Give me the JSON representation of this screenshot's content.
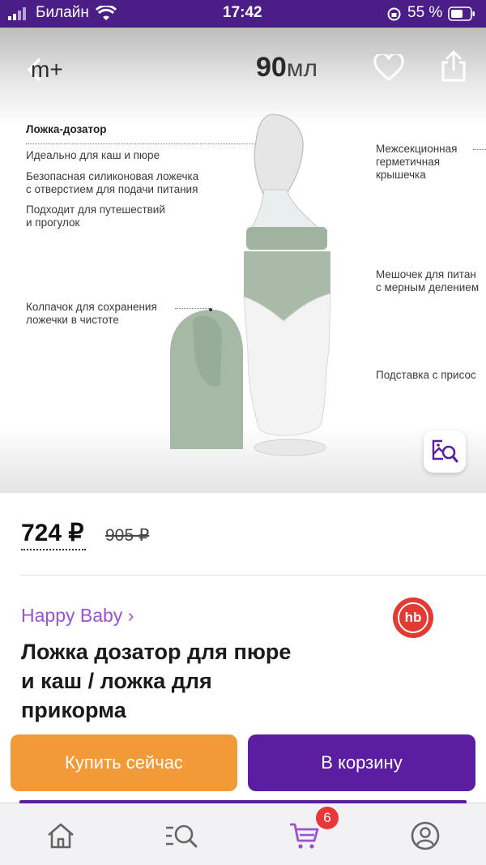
{
  "status": {
    "carrier": "Билайн",
    "time": "17:42",
    "battery": "55 %"
  },
  "hero": {
    "brand_logo": "m+",
    "volume_number": "90",
    "volume_unit": "мл",
    "notes": {
      "spoon_title": "Ложка-дозатор",
      "feature1": "Идеально для каш и пюре",
      "feature2": "Безопасная силиконовая ложечка\nс отверстием для подачи питания",
      "feature3": "Подходит для путешествий\nи прогулок",
      "cap": "Колпачок для сохранения\nложечки в чистоте",
      "lid": "Межсекционная\nгерметичная\nкрышечка",
      "bag": "Мешочек для питан\nс мерным делением",
      "stand": "Подставка с присос"
    }
  },
  "price": {
    "current": "724 ₽",
    "old": "905 ₽"
  },
  "brand": {
    "name": "Happy Baby ›",
    "logo_text": "hb"
  },
  "product": {
    "title": "Ложка дозатор для пюре\nи каш / ложка для\nприкорма"
  },
  "actions": {
    "buy_now": "Купить сейчас",
    "add_to_cart": "В корзину"
  },
  "tabbar": {
    "cart_badge": "6"
  },
  "colors": {
    "purple": "#4a1e86",
    "orange": "#f29a37",
    "brand_link": "#9b52d4",
    "button_purple": "#5b1ea0",
    "badge": "#e8373a"
  }
}
